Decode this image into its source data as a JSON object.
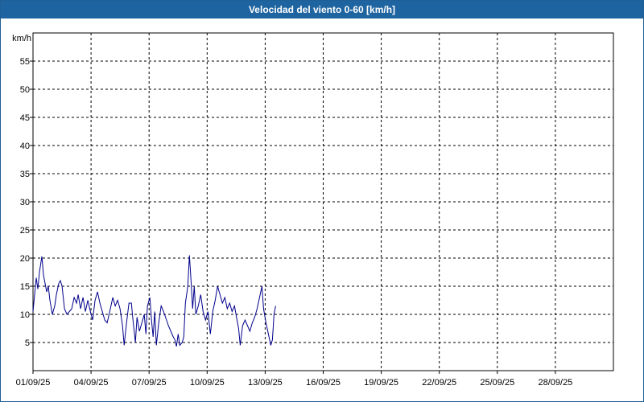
{
  "window": {
    "title": "Velocidad del viento 0-60 [km/h]"
  },
  "chart_data": {
    "type": "line",
    "title": "Velocidad del viento 0-60 [km/h]",
    "ylabel": "km/h",
    "xlabel": "",
    "ylim": [
      0,
      60
    ],
    "x_domain": [
      "2025-09-01",
      "2025-10-01"
    ],
    "y_ticks": [
      5,
      10,
      15,
      20,
      25,
      30,
      35,
      40,
      45,
      50,
      55
    ],
    "x_tick_labels": [
      "01/09/25",
      "04/09/25",
      "07/09/25",
      "10/09/25",
      "13/09/25",
      "16/09/25",
      "19/09/25",
      "22/09/25",
      "25/09/25",
      "28/09/25"
    ],
    "x_tick_dates": [
      "2025-09-01",
      "2025-09-04",
      "2025-09-07",
      "2025-09-10",
      "2025-09-13",
      "2025-09-16",
      "2025-09-19",
      "2025-09-22",
      "2025-09-25",
      "2025-09-28"
    ],
    "grid": true,
    "line_color": "#00008b",
    "series": [
      {
        "values": [
          [
            "2025-09-01 00:00",
            10.5
          ],
          [
            "2025-09-01 02:00",
            13.5
          ],
          [
            "2025-09-01 04:00",
            16.5
          ],
          [
            "2025-09-01 06:00",
            14.5
          ],
          [
            "2025-09-01 08:00",
            17.5
          ],
          [
            "2025-09-01 11:00",
            20.3
          ],
          [
            "2025-09-01 13:00",
            17.0
          ],
          [
            "2025-09-01 15:00",
            15.5
          ],
          [
            "2025-09-01 17:00",
            14.0
          ],
          [
            "2025-09-01 19:00",
            15.0
          ],
          [
            "2025-09-01 21:00",
            12.5
          ],
          [
            "2025-09-02 00:00",
            10.0
          ],
          [
            "2025-09-02 03:00",
            11.5
          ],
          [
            "2025-09-02 05:00",
            13.5
          ],
          [
            "2025-09-02 08:00",
            15.5
          ],
          [
            "2025-09-02 10:00",
            16.0
          ],
          [
            "2025-09-02 12:00",
            15.0
          ],
          [
            "2025-09-02 15:00",
            11.0
          ],
          [
            "2025-09-02 18:00",
            10.0
          ],
          [
            "2025-09-02 21:00",
            10.5
          ],
          [
            "2025-09-03 00:00",
            11.0
          ],
          [
            "2025-09-03 03:00",
            13.0
          ],
          [
            "2025-09-03 06:00",
            12.0
          ],
          [
            "2025-09-03 08:00",
            13.5
          ],
          [
            "2025-09-03 11:00",
            11.0
          ],
          [
            "2025-09-03 14:00",
            13.0
          ],
          [
            "2025-09-03 17:00",
            10.5
          ],
          [
            "2025-09-03 20:00",
            12.5
          ],
          [
            "2025-09-04 00:00",
            10.0
          ],
          [
            "2025-09-04 02:00",
            9.0
          ],
          [
            "2025-09-04 05:00",
            12.5
          ],
          [
            "2025-09-04 08:00",
            14.0
          ],
          [
            "2025-09-04 11:00",
            12.0
          ],
          [
            "2025-09-04 14:00",
            10.5
          ],
          [
            "2025-09-04 17:00",
            9.0
          ],
          [
            "2025-09-04 20:00",
            8.5
          ],
          [
            "2025-09-05 00:00",
            11.0
          ],
          [
            "2025-09-05 03:00",
            13.0
          ],
          [
            "2025-09-05 06:00",
            11.5
          ],
          [
            "2025-09-05 09:00",
            12.5
          ],
          [
            "2025-09-05 12:00",
            11.0
          ],
          [
            "2025-09-05 15:00",
            8.0
          ],
          [
            "2025-09-05 17:00",
            4.5
          ],
          [
            "2025-09-05 20:00",
            8.5
          ],
          [
            "2025-09-05 23:00",
            12.0
          ],
          [
            "2025-09-06 02:00",
            12.0
          ],
          [
            "2025-09-06 04:00",
            9.0
          ],
          [
            "2025-09-06 07:00",
            5.0
          ],
          [
            "2025-09-06 09:00",
            9.5
          ],
          [
            "2025-09-06 12:00",
            7.0
          ],
          [
            "2025-09-06 15:00",
            8.5
          ],
          [
            "2025-09-06 18:00",
            10.0
          ],
          [
            "2025-09-06 20:00",
            6.5
          ],
          [
            "2025-09-06 22:00",
            11.5
          ],
          [
            "2025-09-07 01:00",
            13.0
          ],
          [
            "2025-09-07 03:00",
            9.0
          ],
          [
            "2025-09-07 05:00",
            6.0
          ],
          [
            "2025-09-07 07:00",
            10.5
          ],
          [
            "2025-09-07 09:00",
            4.5
          ],
          [
            "2025-09-07 12:00",
            8.5
          ],
          [
            "2025-09-07 15:00",
            11.5
          ],
          [
            "2025-09-07 18:00",
            10.5
          ],
          [
            "2025-09-08 00:00",
            8.0
          ],
          [
            "2025-09-08 03:00",
            7.0
          ],
          [
            "2025-09-08 06:00",
            6.0
          ],
          [
            "2025-09-08 08:00",
            5.5
          ],
          [
            "2025-09-08 10:00",
            4.3
          ],
          [
            "2025-09-08 12:00",
            6.5
          ],
          [
            "2025-09-08 14:00",
            4.5
          ],
          [
            "2025-09-08 17:00",
            5.0
          ],
          [
            "2025-09-08 19:00",
            6.0
          ],
          [
            "2025-09-08 21:00",
            12.0
          ],
          [
            "2025-09-09 00:00",
            15.0
          ],
          [
            "2025-09-09 02:00",
            20.5
          ],
          [
            "2025-09-09 04:00",
            16.0
          ],
          [
            "2025-09-09 06:00",
            11.0
          ],
          [
            "2025-09-09 08:00",
            15.0
          ],
          [
            "2025-09-09 10:00",
            10.0
          ],
          [
            "2025-09-09 13:00",
            11.5
          ],
          [
            "2025-09-09 16:00",
            13.5
          ],
          [
            "2025-09-09 19:00",
            10.5
          ],
          [
            "2025-09-09 22:00",
            9.0
          ],
          [
            "2025-09-10 01:00",
            10.5
          ],
          [
            "2025-09-10 04:00",
            6.5
          ],
          [
            "2025-09-10 07:00",
            10.5
          ],
          [
            "2025-09-10 10:00",
            12.5
          ],
          [
            "2025-09-10 13:00",
            15.0
          ],
          [
            "2025-09-10 16:00",
            13.5
          ],
          [
            "2025-09-10 19:00",
            12.0
          ],
          [
            "2025-09-10 22:00",
            13.0
          ],
          [
            "2025-09-11 01:00",
            11.0
          ],
          [
            "2025-09-11 04:00",
            12.0
          ],
          [
            "2025-09-11 07:00",
            10.5
          ],
          [
            "2025-09-11 10:00",
            11.5
          ],
          [
            "2025-09-11 13:00",
            9.0
          ],
          [
            "2025-09-11 15:00",
            7.5
          ],
          [
            "2025-09-11 17:00",
            4.5
          ],
          [
            "2025-09-11 20:00",
            8.0
          ],
          [
            "2025-09-11 23:00",
            9.0
          ],
          [
            "2025-09-12 02:00",
            8.0
          ],
          [
            "2025-09-12 05:00",
            7.0
          ],
          [
            "2025-09-12 08:00",
            8.5
          ],
          [
            "2025-09-12 11:00",
            9.5
          ],
          [
            "2025-09-12 14:00",
            11.0
          ],
          [
            "2025-09-12 17:00",
            13.0
          ],
          [
            "2025-09-12 20:00",
            15.0
          ],
          [
            "2025-09-12 22:00",
            11.0
          ],
          [
            "2025-09-13 01:00",
            8.5
          ],
          [
            "2025-09-13 04:00",
            6.5
          ],
          [
            "2025-09-13 07:00",
            4.5
          ],
          [
            "2025-09-13 09:00",
            5.5
          ],
          [
            "2025-09-13 11:00",
            10.0
          ],
          [
            "2025-09-13 13:00",
            11.5
          ]
        ]
      }
    ]
  }
}
